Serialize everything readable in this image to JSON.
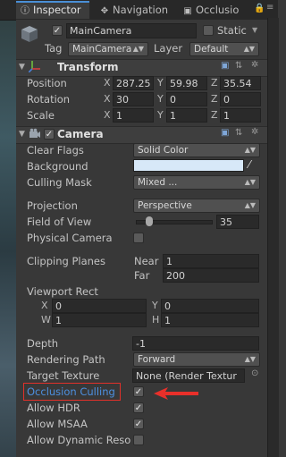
{
  "tabs": [
    {
      "label": "Inspector",
      "icon": "info-icon",
      "active": true
    },
    {
      "label": "Navigation",
      "icon": "navigation-icon",
      "active": false
    },
    {
      "label": "Occlusio",
      "icon": "occlusion-icon",
      "active": false
    }
  ],
  "gameobject": {
    "active": true,
    "name": "MainCamera",
    "static_label": "Static",
    "static_checked": false,
    "tag_label": "Tag",
    "tag_value": "MainCamera",
    "layer_label": "Layer",
    "layer_value": "Default"
  },
  "transform": {
    "title": "Transform",
    "position_label": "Position",
    "rotation_label": "Rotation",
    "scale_label": "Scale",
    "position": {
      "x": "287.25",
      "y": "59.98",
      "z": "35.54"
    },
    "rotation": {
      "x": "30",
      "y": "0",
      "z": "0"
    },
    "scale": {
      "x": "1",
      "y": "1",
      "z": "1"
    }
  },
  "axis": {
    "x": "X",
    "y": "Y",
    "z": "Z",
    "w": "W",
    "h": "H"
  },
  "camera": {
    "title": "Camera",
    "enabled": true,
    "clear_flags_label": "Clear Flags",
    "clear_flags_value": "Solid Color",
    "background_label": "Background",
    "background_color": "#d7e8f8",
    "culling_mask_label": "Culling Mask",
    "culling_mask_value": "Mixed ...",
    "projection_label": "Projection",
    "projection_value": "Perspective",
    "fov_label": "Field of View",
    "fov_value": "35",
    "fov_fraction": 0.18,
    "physical_camera_label": "Physical Camera",
    "physical_camera_checked": false,
    "clipping_planes_label": "Clipping Planes",
    "near_label": "Near",
    "near_value": "1",
    "far_label": "Far",
    "far_value": "200",
    "viewport_rect_label": "Viewport Rect",
    "viewport": {
      "x": "0",
      "y": "0",
      "w": "1",
      "h": "1"
    },
    "depth_label": "Depth",
    "depth_value": "-1",
    "rendering_path_label": "Rendering Path",
    "rendering_path_value": "Forward",
    "target_texture_label": "Target Texture",
    "target_texture_value": "None (Render Textur",
    "occlusion_culling_label": "Occlusion Culling",
    "occlusion_culling_checked": true,
    "allow_hdr_label": "Allow HDR",
    "allow_hdr_checked": true,
    "allow_msaa_label": "Allow MSAA",
    "allow_msaa_checked": true,
    "allow_dynamic_label": "Allow Dynamic Reso",
    "allow_dynamic_checked": false
  },
  "annotation": {
    "highlight_color": "#e0302a",
    "arrow_color": "#e8302a"
  },
  "colors": {
    "tab_accent": "#4a8fd6",
    "occlusion_label_color": "#4d90e0"
  }
}
